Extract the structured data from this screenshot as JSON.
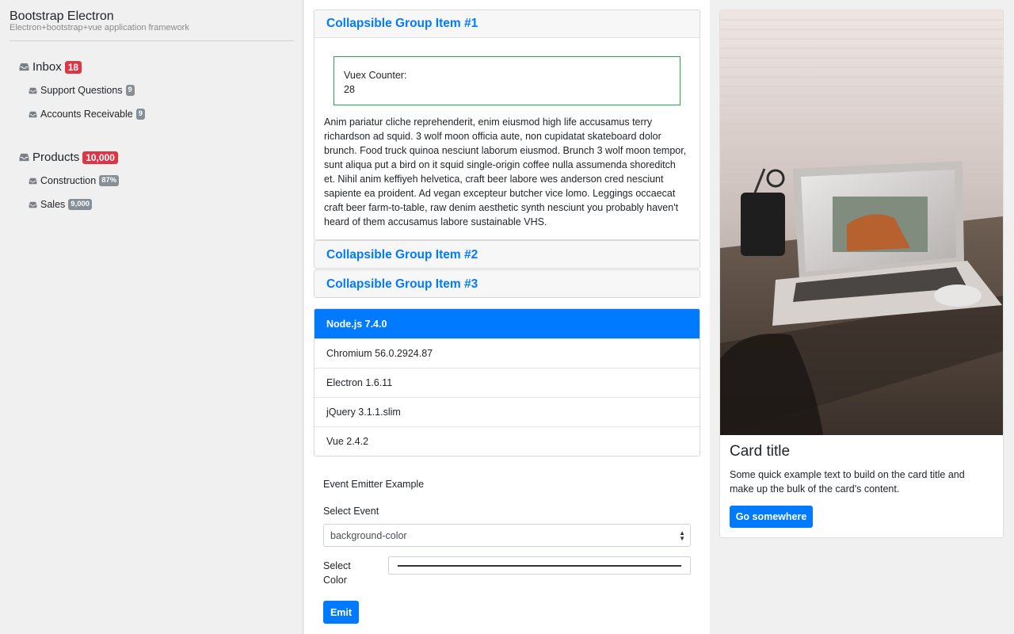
{
  "app": {
    "title": "Bootstrap Electron",
    "subtitle": "Electron+bootstrap+vue application framework"
  },
  "sidebar": {
    "groups": [
      {
        "label": "Inbox",
        "badge": "18",
        "icon": "inbox-tray-icon",
        "items": [
          {
            "label": "Support Questions",
            "badge": "9",
            "icon": "inbox-tray-icon"
          },
          {
            "label": "Accounts Receivable",
            "badge": "9",
            "icon": "inbox-tray-icon"
          }
        ]
      },
      {
        "label": "Products",
        "badge": "10,000",
        "icon": "inbox-tray-icon",
        "items": [
          {
            "label": "Construction",
            "badge": "87%",
            "icon": "inbox-tray-icon"
          },
          {
            "label": "Sales",
            "badge": "9,000",
            "icon": "inbox-tray-icon"
          }
        ]
      }
    ]
  },
  "accordion": {
    "items": [
      {
        "title": "Collapsible Group Item #1",
        "expanded": true
      },
      {
        "title": "Collapsible Group Item #2",
        "expanded": false
      },
      {
        "title": "Collapsible Group Item #3",
        "expanded": false
      }
    ],
    "counter_label": "Vuex Counter:",
    "counter_value": "28",
    "body_text": "Anim pariatur cliche reprehenderit, enim eiusmod high life accusamus terry richardson ad squid. 3 wolf moon officia aute, non cupidatat skateboard dolor brunch. Food truck quinoa nesciunt laborum eiusmod. Brunch 3 wolf moon tempor, sunt aliqua put a bird on it squid single-origin coffee nulla assumenda shoreditch et. Nihil anim keffiyeh helvetica, craft beer labore wes anderson cred nesciunt sapiente ea proident. Ad vegan excepteur butcher vice lomo. Leggings occaecat craft beer farm-to-table, raw denim aesthetic synth nesciunt you probably haven't heard of them accusamus labore sustainable VHS."
  },
  "versions": {
    "items": [
      "Node.js 7.4.0",
      "Chromium 56.0.2924.87",
      "Electron 1.6.11",
      "jQuery 3.1.1.slim",
      "Vue 2.4.2"
    ],
    "active_index": 0
  },
  "emitter": {
    "title": "Event Emitter Example",
    "select_label": "Select Event",
    "select_value": "background-color",
    "color_label": "Select Color",
    "color_value": "#333333",
    "emit_label": "Emit"
  },
  "card": {
    "title": "Card title",
    "text": "Some quick example text to build on the card title and make up the bulk of the card's content.",
    "button_label": "Go somewhere"
  },
  "colors": {
    "primary": "#007bff",
    "danger": "#dc3545",
    "secondary": "#868e96",
    "success": "#28a745",
    "sidebar_bg": "#f0f0f0"
  }
}
